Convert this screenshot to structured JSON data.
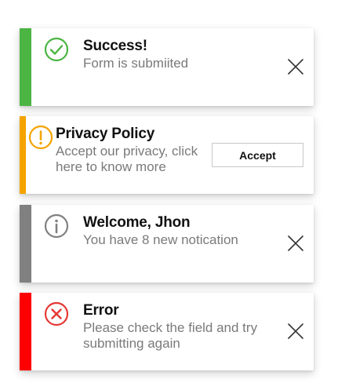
{
  "colors": {
    "success": "#4bb543",
    "warning": "#f5a300",
    "info": "#808080",
    "error": "#ff0000"
  },
  "toasts": [
    {
      "type": "success",
      "icon": "check-circle-icon",
      "title": "Success!",
      "message": "Form is submiited",
      "action": "close"
    },
    {
      "type": "warning",
      "icon": "exclamation-circle-icon",
      "title": "Privacy Policy",
      "message": "Accept our privacy, click here to know more",
      "action": "accept",
      "accept_label": "Accept"
    },
    {
      "type": "info",
      "icon": "info-circle-icon",
      "title": "Welcome, Jhon",
      "message": "You have 8 new notication",
      "action": "close"
    },
    {
      "type": "error",
      "icon": "x-circle-icon",
      "title": "Error",
      "message": "Please check the field and try submitting again",
      "action": "close"
    }
  ]
}
